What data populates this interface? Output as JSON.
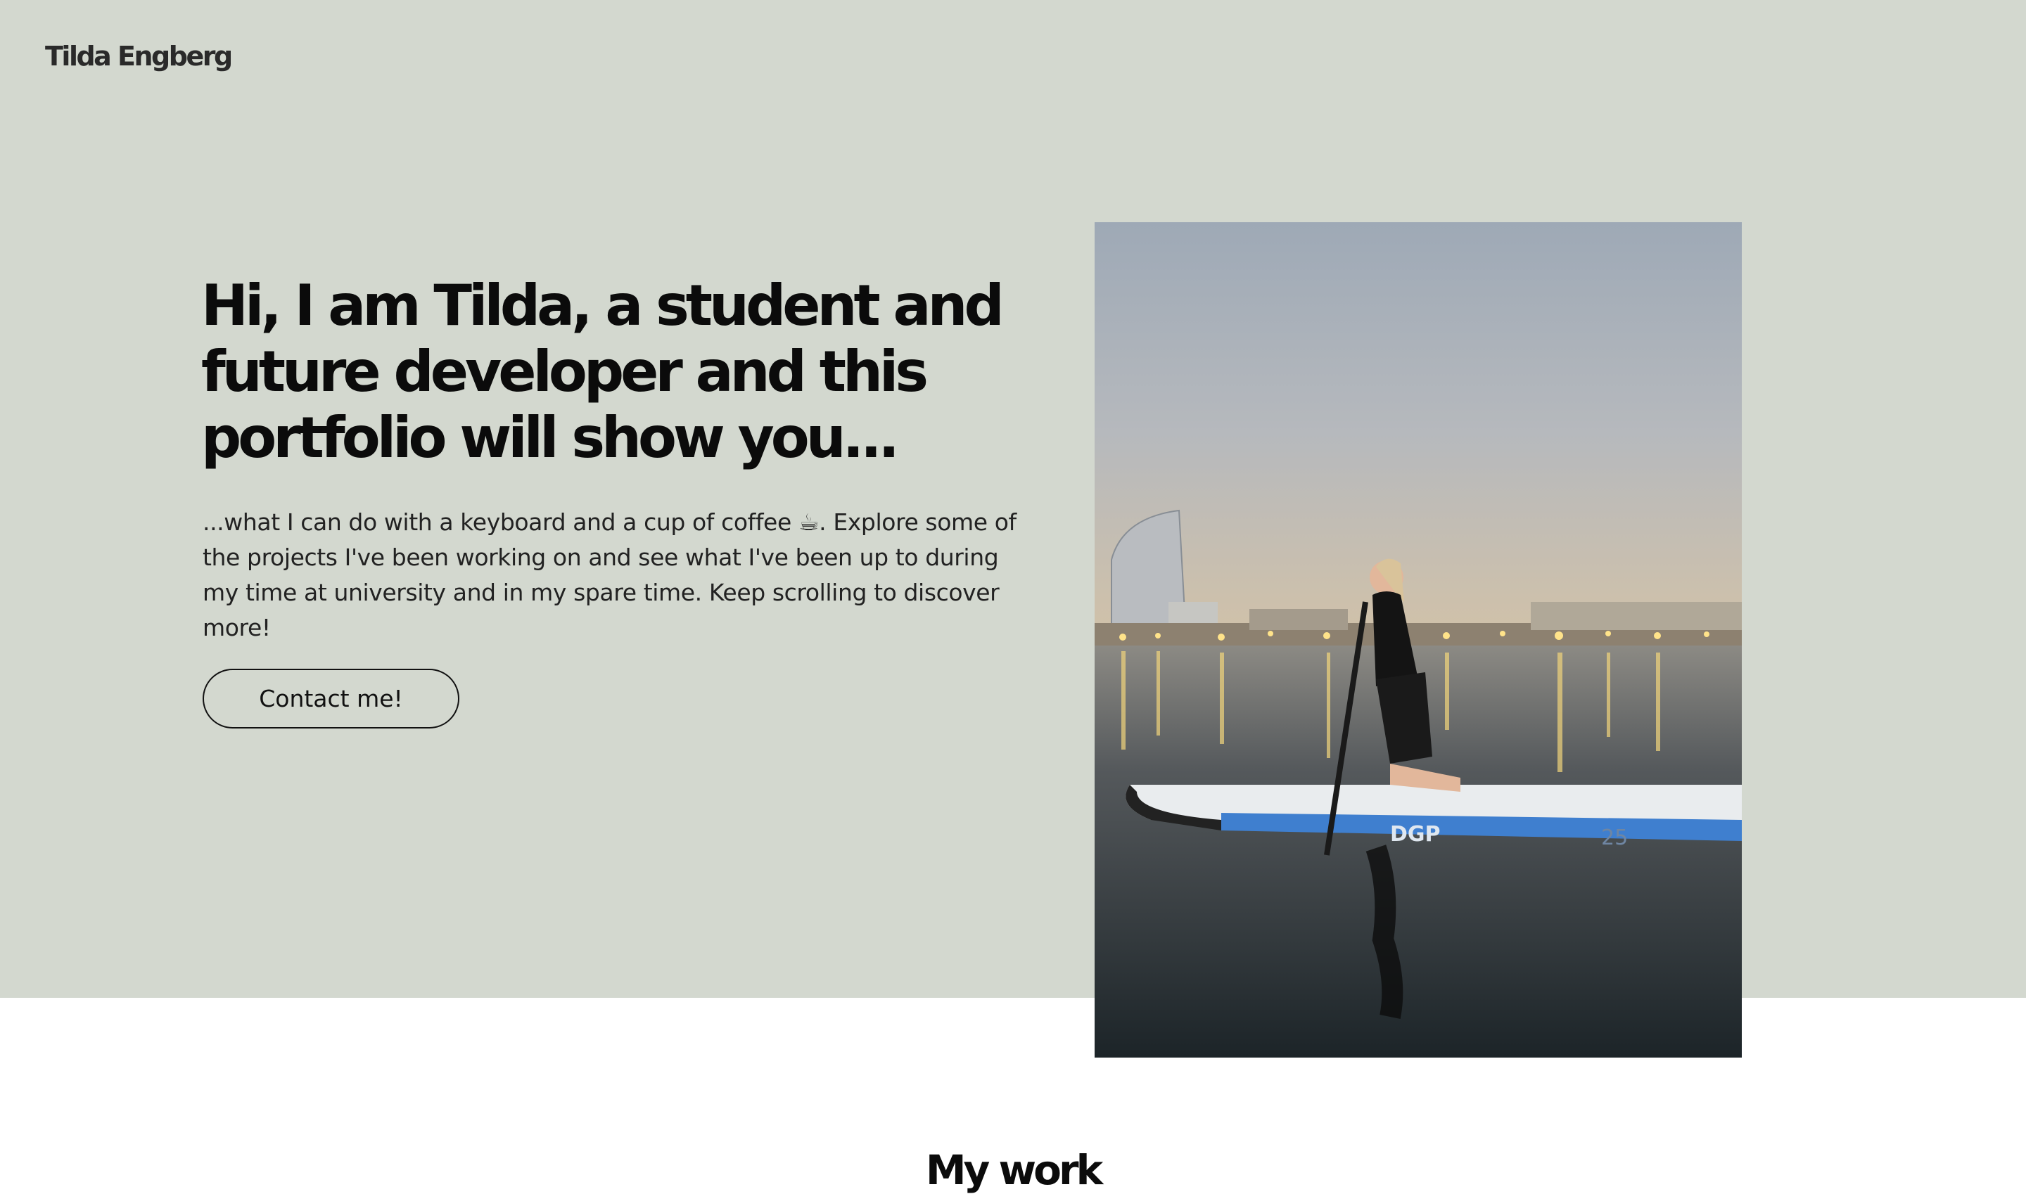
{
  "header": {
    "logo_text": "Tilda Engberg"
  },
  "hero": {
    "headline": "Hi, I am Tilda, a student and future developer and this portfolio will show you...",
    "intro": "...what I can do with a keyboard and a cup of coffee ☕. Explore some of the projects I've been working on and see what I've been up to during my time at university and in my spare time. Keep scrolling to discover more!",
    "contact_button_label": "Contact me!",
    "photo_alt": "Tilda kneeling on a paddleboard at dusk with a city skyline behind",
    "board_brand": "DGP",
    "board_number": "25"
  },
  "work": {
    "title": "My work"
  },
  "colors": {
    "hero_background": "#d3d8cf",
    "page_background": "#ffffff",
    "text": "#0b0b0b",
    "board_blue": "#3f7fcf"
  }
}
